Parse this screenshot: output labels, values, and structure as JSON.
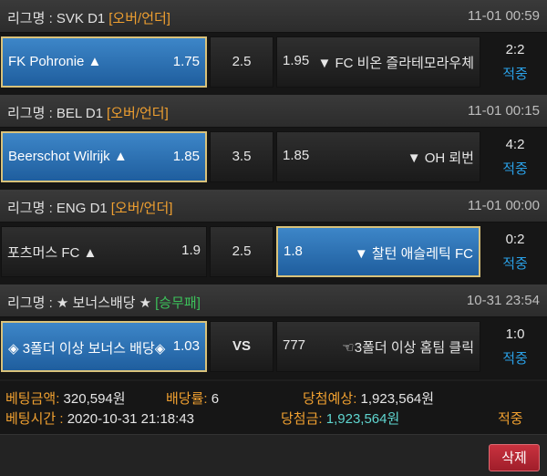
{
  "bets": [
    {
      "league_label": "리그명 : SVK D1",
      "bet_type": "[오버/언더]",
      "time": "11-01 00:59",
      "home": "FK Pohronie ▲",
      "home_odds": "1.75",
      "mid": "2.5",
      "away_odds": "1.95",
      "away": "▼ FC 비온 즐라테모라우체",
      "score": "2:2",
      "status": "적중"
    },
    {
      "league_label": "리그명 : BEL D1",
      "bet_type": "[오버/언더]",
      "time": "11-01 00:15",
      "home": "Beerschot Wilrijk ▲",
      "home_odds": "1.85",
      "mid": "3.5",
      "away_odds": "1.85",
      "away": "▼ OH 뢰번",
      "score": "4:2",
      "status": "적중"
    },
    {
      "league_label": "리그명 : ENG D1",
      "bet_type": "[오버/언더]",
      "time": "11-01 00:00",
      "home": "포츠머스 FC ▲",
      "home_odds": "1.9",
      "mid": "2.5",
      "away_odds": "1.8",
      "away": "▼ 찰턴 애슬레틱 FC",
      "score": "0:2",
      "status": "적중"
    },
    {
      "league_label": "리그명 : ★ 보너스배당 ★",
      "bet_type": "[승무패]",
      "time": "10-31 23:54",
      "home": "◈ 3폴더 이상 보너스 배당◈",
      "home_odds": "1.03",
      "mid": "VS",
      "away_odds": "777",
      "away": "☜3폴더 이상 홈팀 클릭",
      "score": "1:0",
      "status": "적중"
    }
  ],
  "summary": {
    "bet_amount_label": "베팅금액:",
    "bet_amount": "320,594원",
    "odds_label": "배당률:",
    "odds": "6",
    "expected_label": "당첨예상:",
    "expected": "1,923,564원",
    "bet_time_label": "베팅시간 :",
    "bet_time": "2020-10-31 21:18:43",
    "win_label": "당첨금:",
    "win": "1,923,564원",
    "result": "적중"
  },
  "delete_label": "삭제",
  "colors": {
    "selected": "#2d72b8",
    "type_orange": "#f0a030",
    "type_green": "#3cc05a",
    "status_blue": "#2aa0e6",
    "win_cyan": "#5fd6d0",
    "delete_red": "#b82835"
  }
}
